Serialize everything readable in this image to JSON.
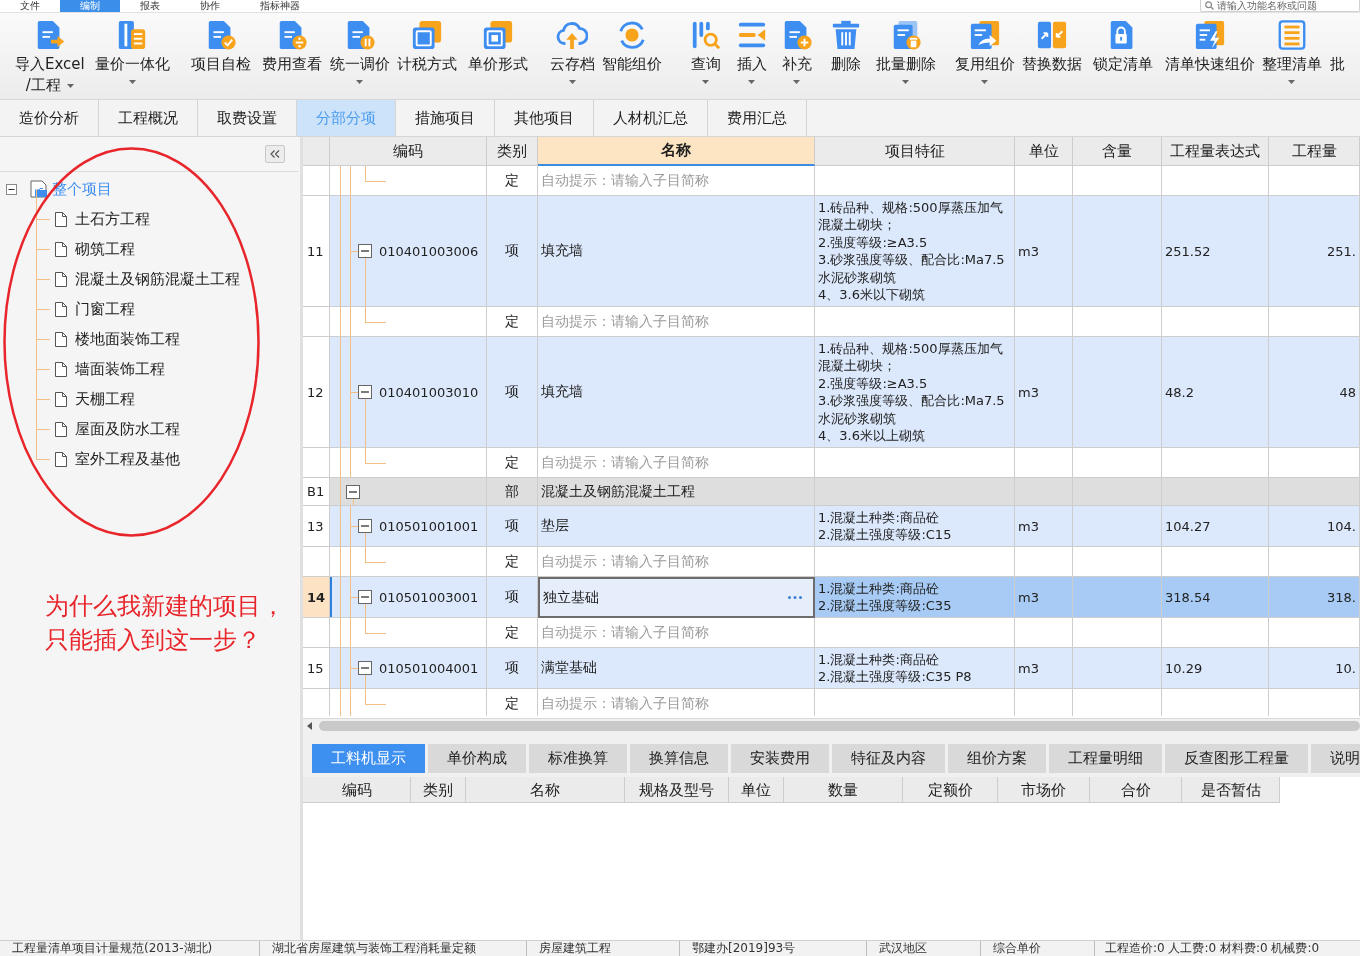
{
  "menu_bar": {
    "items": [
      {
        "label": "文件",
        "selected": false
      },
      {
        "label": "编制",
        "selected": true
      },
      {
        "label": "报表",
        "selected": false
      },
      {
        "label": "协作",
        "selected": false
      },
      {
        "label": "指标神器",
        "selected": false
      }
    ],
    "search": {
      "placeholder": "请输入功能名称或问题"
    }
  },
  "toolbar": [
    {
      "label": "导入Excel\n/工程",
      "has_menu": true
    },
    {
      "label": "量价一体化",
      "has_menu": true
    },
    {
      "label": "项目自检",
      "has_menu": false
    },
    {
      "label": "费用查看",
      "has_menu": false
    },
    {
      "label": "统一调价",
      "has_menu": true
    },
    {
      "label": "计税方式",
      "has_menu": false
    },
    {
      "label": "单价形式",
      "has_menu": false
    },
    {
      "label": "云存档",
      "has_menu": true
    },
    {
      "label": "智能组价",
      "has_menu": false
    },
    {
      "label": "查询",
      "has_menu": true
    },
    {
      "label": "插入",
      "has_menu": true
    },
    {
      "label": "补充",
      "has_menu": true
    },
    {
      "label": "删除",
      "has_menu": false
    },
    {
      "label": "批量删除",
      "has_menu": true
    },
    {
      "label": "复用组价",
      "has_menu": true
    },
    {
      "label": "替换数据",
      "has_menu": false
    },
    {
      "label": "锁定清单",
      "has_menu": false
    },
    {
      "label": "清单快速组价",
      "has_menu": false
    },
    {
      "label": "整理清单",
      "has_menu": true
    },
    {
      "label": "批",
      "has_menu": false
    }
  ],
  "tabs": [
    {
      "label": "造价分析",
      "selected": false
    },
    {
      "label": "工程概况",
      "selected": false
    },
    {
      "label": "取费设置",
      "selected": false
    },
    {
      "label": "分部分项",
      "selected": true
    },
    {
      "label": "措施项目",
      "selected": false
    },
    {
      "label": "其他项目",
      "selected": false
    },
    {
      "label": "人材机汇总",
      "selected": false
    },
    {
      "label": "费用汇总",
      "selected": false
    }
  ],
  "project_tree": {
    "root": {
      "label": "整个项目",
      "expanded": true,
      "selected": true,
      "children": [
        {
          "label": "土石方工程",
          "selected": false
        },
        {
          "label": "砌筑工程",
          "selected": false
        },
        {
          "label": "混凝土及钢筋混凝土工程",
          "selected": false
        },
        {
          "label": "门窗工程",
          "selected": false
        },
        {
          "label": "楼地面装饰工程",
          "selected": false
        },
        {
          "label": "墙面装饰工程",
          "selected": false
        },
        {
          "label": "天棚工程",
          "selected": false
        },
        {
          "label": "屋面及防水工程",
          "selected": false
        },
        {
          "label": "室外工程及基他",
          "selected": false
        }
      ]
    }
  },
  "annotation": {
    "text": "为什么我新建的项目，只能插入到这一步？"
  },
  "table": {
    "columns": [
      {
        "label": "编码",
        "selected": false
      },
      {
        "label": "类别",
        "selected": false
      },
      {
        "label": "名称",
        "selected": true
      },
      {
        "label": "项目特征",
        "selected": false
      },
      {
        "label": "单位",
        "selected": false
      },
      {
        "label": "含量",
        "selected": false
      },
      {
        "label": "工程量表达式",
        "selected": false
      },
      {
        "label": "工程量",
        "selected": false
      }
    ],
    "rows": [
      {
        "kind": "sub",
        "type": "定",
        "hint": "自动提示：请输入子目简称",
        "selected": false
      },
      {
        "kind": "item",
        "number": "11",
        "code": "010401003006",
        "type": "项",
        "name": "填充墙",
        "features": [
          "1.砖品种、规格:500厚蒸压加气混凝土砌块；",
          "2.强度等级:≥A3.5",
          "3.砂浆强度等级、配合比:Ma7.5水泥砂浆砌筑",
          "4、3.6米以下砌筑"
        ],
        "unit": "m3",
        "quantity_expression": "251.52",
        "quantity": "251.",
        "expanded": true,
        "selected": false
      },
      {
        "kind": "sub",
        "type": "定",
        "hint": "自动提示：请输入子目简称",
        "selected": false
      },
      {
        "kind": "item",
        "number": "12",
        "code": "010401003010",
        "type": "项",
        "name": "填充墙",
        "features": [
          "1.砖品种、规格:500厚蒸压加气混凝土砌块；",
          "2.强度等级:≥A3.5",
          "3.砂浆强度等级、配合比:Ma7.5水泥砂浆砌筑",
          "4、3.6米以上砌筑"
        ],
        "unit": "m3",
        "quantity_expression": "48.2",
        "quantity": "48",
        "expanded": true,
        "selected": false
      },
      {
        "kind": "sub",
        "type": "定",
        "hint": "自动提示：请输入子目简称",
        "selected": false
      },
      {
        "kind": "section",
        "number": "B1",
        "type": "部",
        "name": "混凝土及钢筋混凝土工程",
        "expanded": true,
        "selected": false
      },
      {
        "kind": "item",
        "number": "13",
        "code": "010501001001",
        "type": "项",
        "name": "垫层",
        "features": [
          "1.混凝土种类:商品砼",
          "2.混凝土强度等级:C15"
        ],
        "unit": "m3",
        "quantity_expression": "104.27",
        "quantity": "104.",
        "expanded": true,
        "selected": false
      },
      {
        "kind": "sub",
        "type": "定",
        "hint": "自动提示：请输入子目简称",
        "selected": false
      },
      {
        "kind": "item",
        "number": "14",
        "code": "010501003001",
        "type": "项",
        "name": "独立基础",
        "features": [
          "1.混凝土种类:商品砼",
          "2.混凝土强度等级:C35"
        ],
        "unit": "m3",
        "quantity_expression": "318.54",
        "quantity": "318.",
        "expanded": true,
        "selected": true
      },
      {
        "kind": "sub",
        "type": "定",
        "hint": "自动提示：请输入子目简称",
        "selected": false
      },
      {
        "kind": "item",
        "number": "15",
        "code": "010501004001",
        "type": "项",
        "name": "满堂基础",
        "features": [
          "1.混凝土种类:商品砼",
          "2.混凝土强度等级:C35 P8"
        ],
        "unit": "m3",
        "quantity_expression": "10.29",
        "quantity": "10.",
        "expanded": true,
        "selected": false
      },
      {
        "kind": "sub",
        "type": "定",
        "hint": "自动提示：请输入子目简称",
        "selected": false
      }
    ]
  },
  "detail_panel": {
    "tabs": [
      {
        "label": "工料机显示",
        "selected": true
      },
      {
        "label": "单价构成",
        "selected": false
      },
      {
        "label": "标准换算",
        "selected": false
      },
      {
        "label": "换算信息",
        "selected": false
      },
      {
        "label": "安装费用",
        "selected": false
      },
      {
        "label": "特征及内容",
        "selected": false
      },
      {
        "label": "组价方案",
        "selected": false
      },
      {
        "label": "工程量明细",
        "selected": false
      },
      {
        "label": "反查图形工程量",
        "selected": false
      },
      {
        "label": "说明",
        "selected": false
      }
    ],
    "columns": [
      "编码",
      "类别",
      "名称",
      "规格及型号",
      "单位",
      "数量",
      "定额价",
      "市场价",
      "合价",
      "是否暂估"
    ]
  },
  "status_bar": [
    "工程量清单项目计量规范(2013-湖北)",
    "湖北省房屋建筑与装饰工程消耗量定额",
    "房屋建筑工程",
    "鄂建办[2019]93号",
    "武汉地区",
    "综合单价",
    "工程造价:0 人工费:0 材料费:0 机械费:0"
  ]
}
